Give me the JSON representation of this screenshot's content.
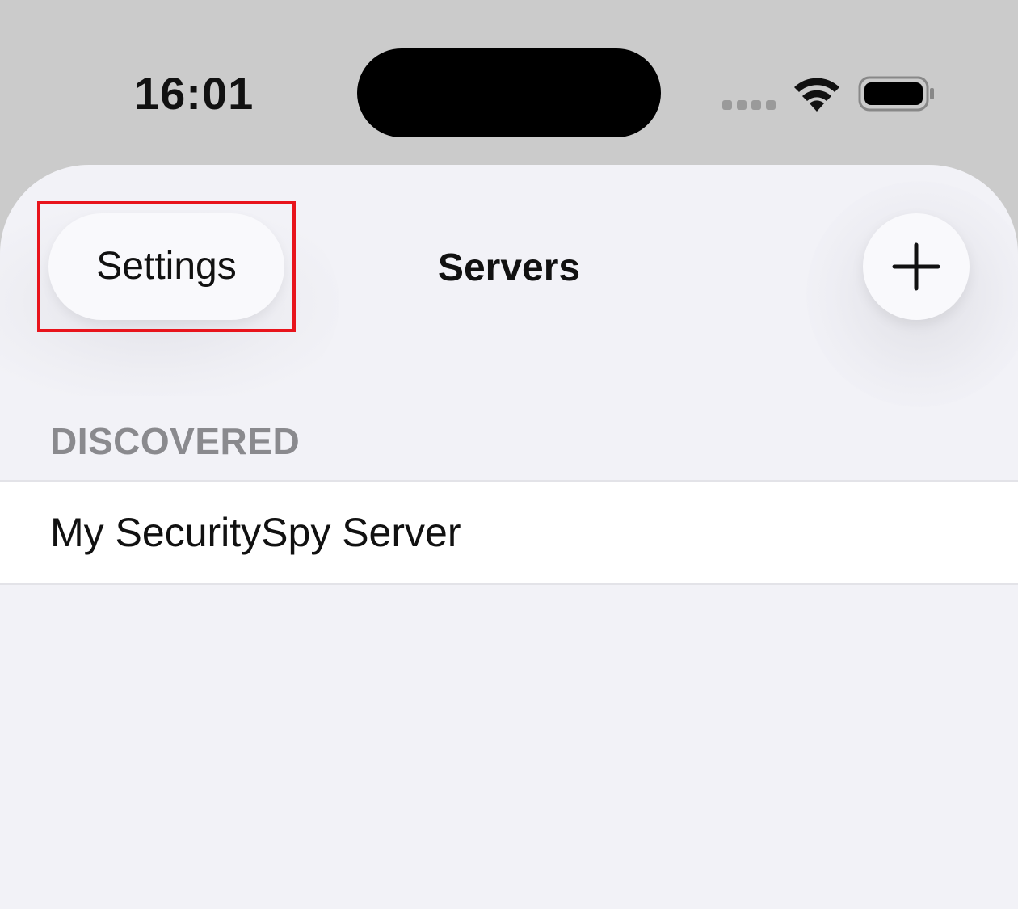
{
  "status_bar": {
    "time": "16:01"
  },
  "nav": {
    "left_button_label": "Settings",
    "title": "Servers",
    "right_button_icon": "plus-icon"
  },
  "sections": [
    {
      "header": "DISCOVERED",
      "rows": [
        {
          "label": "My SecuritySpy Server"
        }
      ]
    }
  ],
  "colors": {
    "highlight": "#e8141c",
    "background": "#f2f2f7",
    "status_bar": "#cbcbcb",
    "section_header": "#8a8a8e"
  }
}
